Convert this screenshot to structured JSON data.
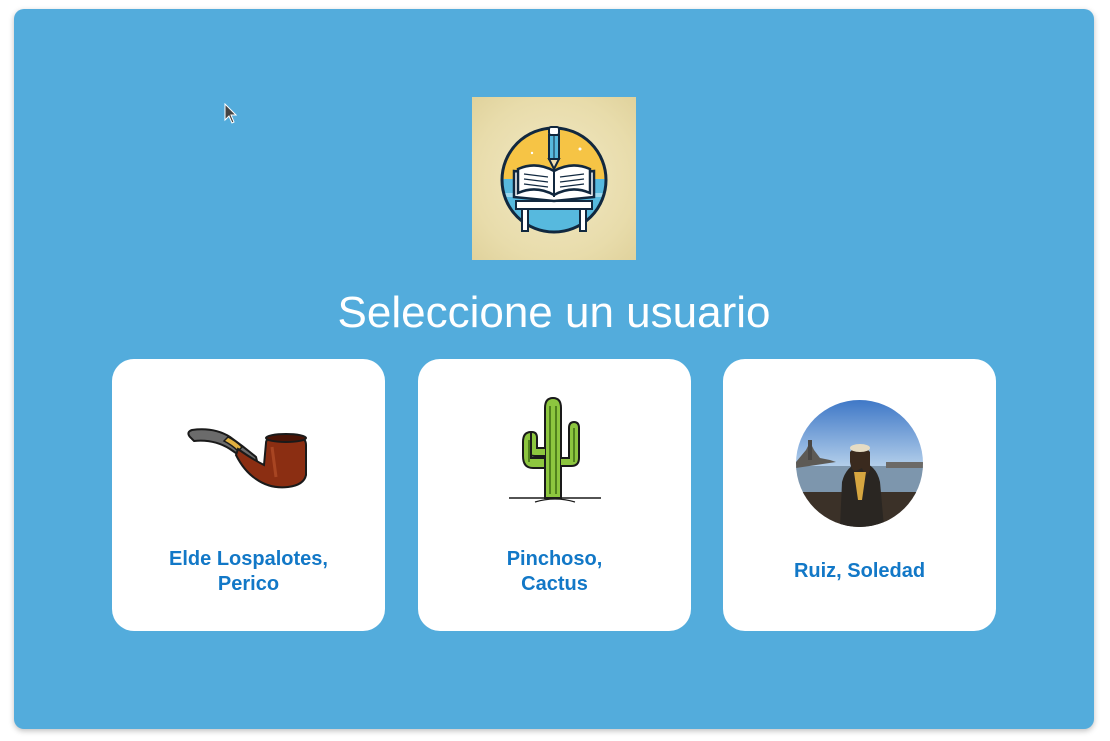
{
  "title": "Seleccione un usuario",
  "users": [
    {
      "name_line1": "Elde Lospalotes,",
      "name_line2": "Perico",
      "icon": "pipe-icon"
    },
    {
      "name_line1": "Pinchoso,",
      "name_line2": "Cactus",
      "icon": "cactus-icon"
    },
    {
      "name": "Ruiz, Soledad",
      "icon": "user-photo-avatar"
    }
  ],
  "colors": {
    "background": "#53acdc",
    "card": "#ffffff",
    "name_text": "#1278c7",
    "title_text": "#ffffff"
  }
}
